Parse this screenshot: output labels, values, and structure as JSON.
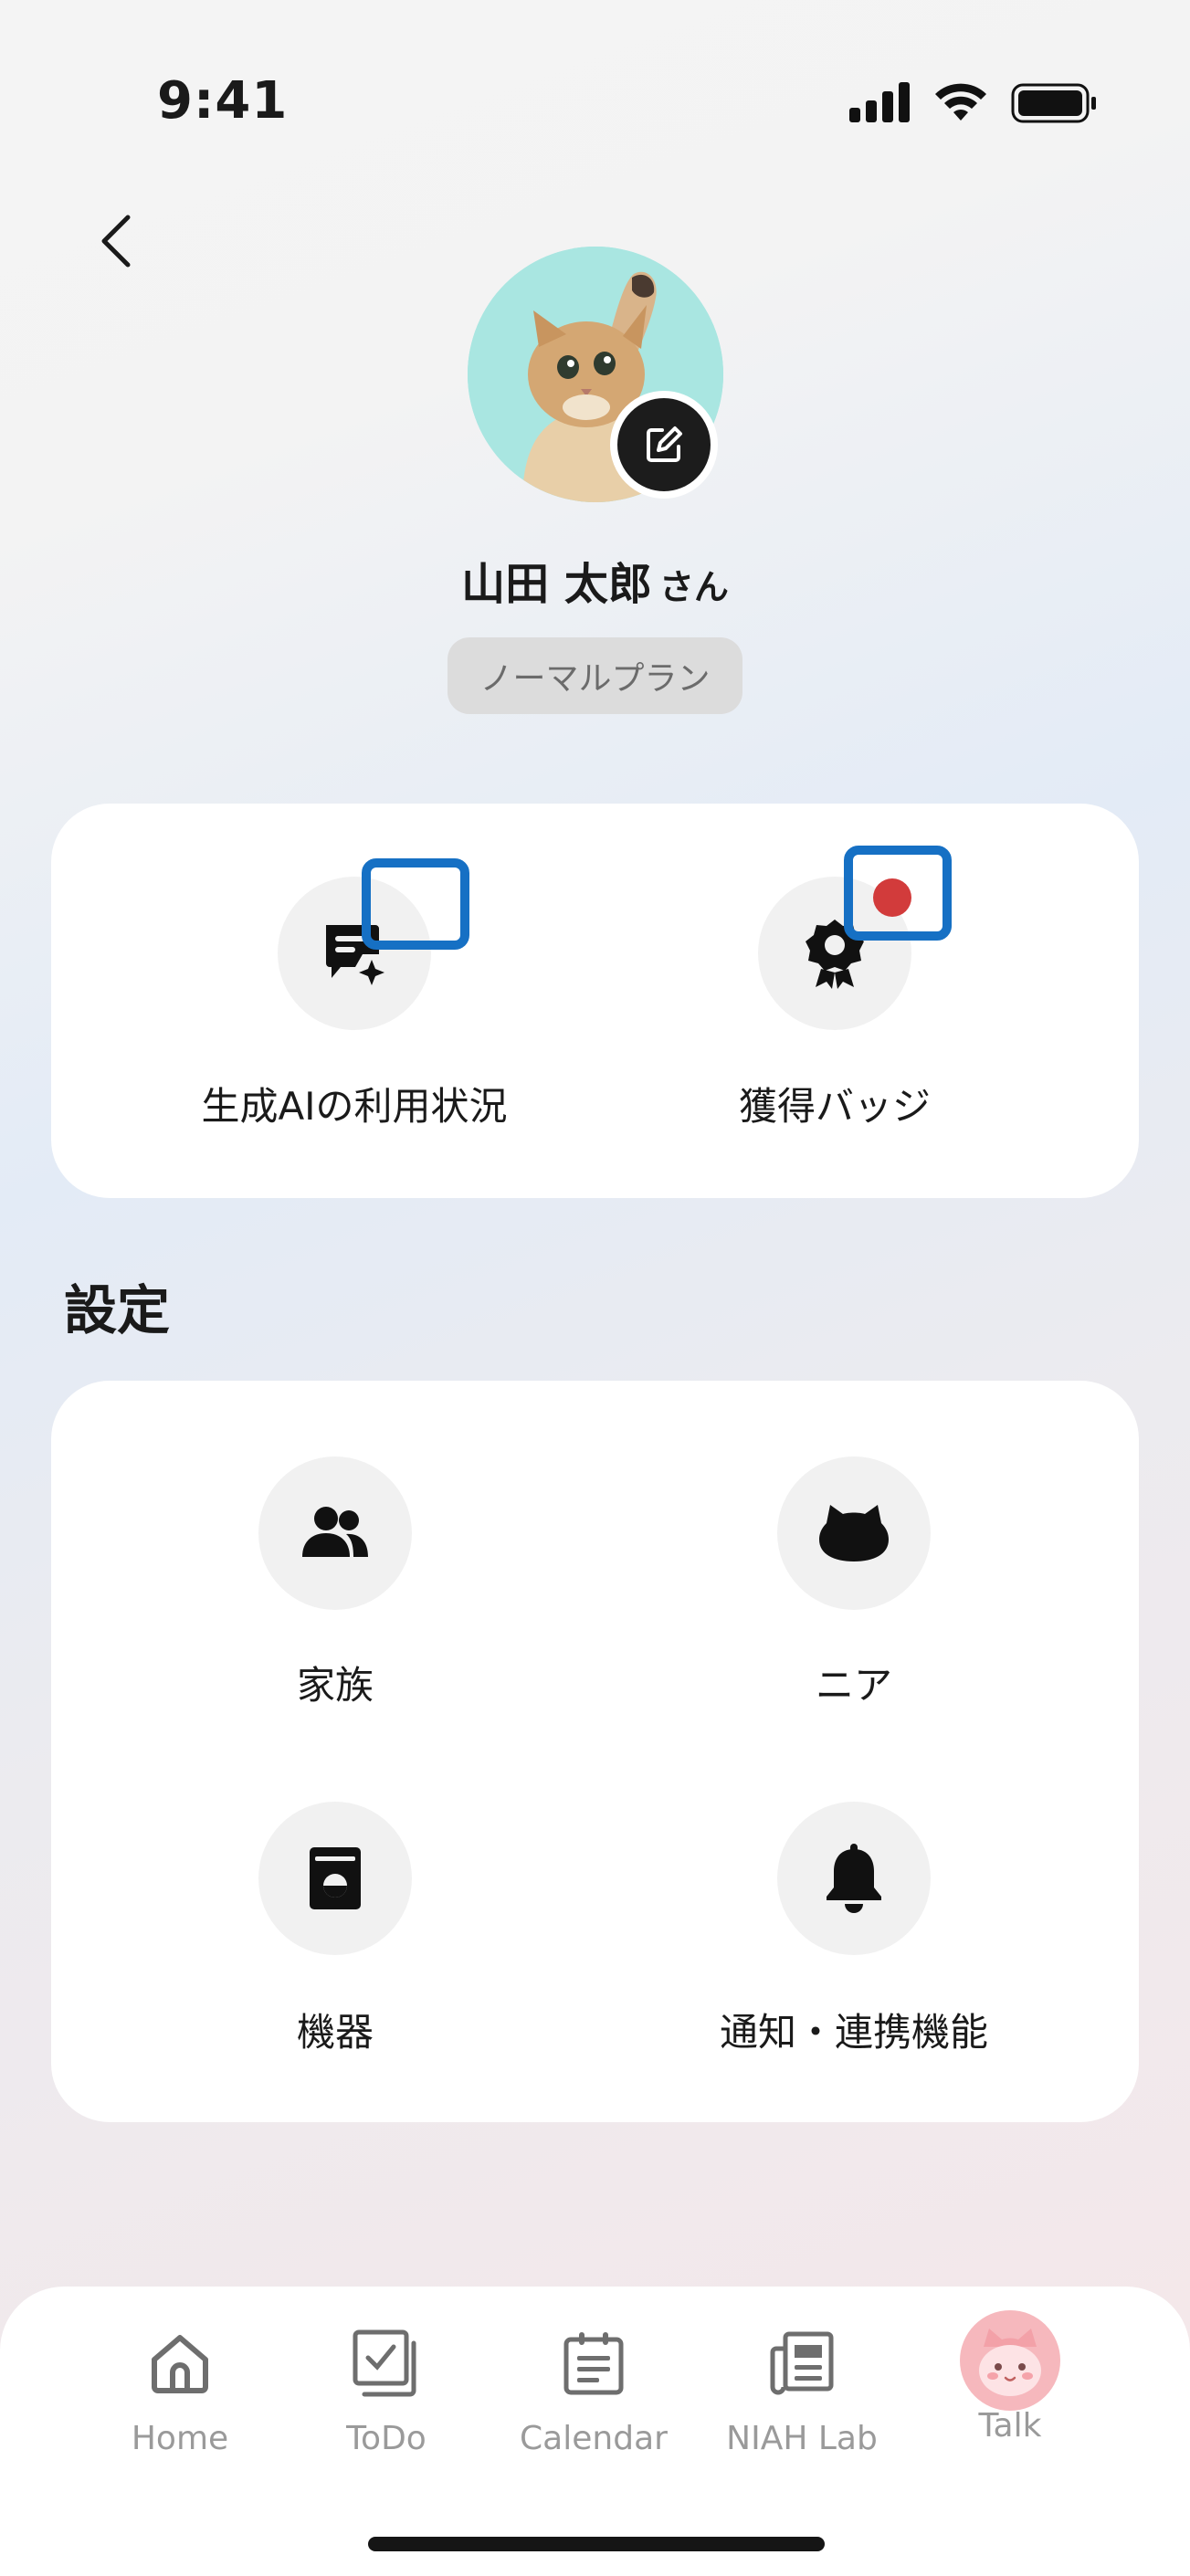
{
  "status_bar": {
    "time": "9:41"
  },
  "profile": {
    "name": "山田 太郎",
    "name_suffix": "さん",
    "plan": "ノーマルプラン"
  },
  "top_card": {
    "items": [
      {
        "label": "生成AIの利用状況",
        "icon": "ai-chat-sparkle-icon"
      },
      {
        "label": "獲得バッジ",
        "icon": "badge-award-icon"
      }
    ]
  },
  "settings": {
    "title": "設定",
    "items": [
      {
        "label": "家族",
        "icon": "people-icon"
      },
      {
        "label": "ニア",
        "icon": "character-face-icon"
      },
      {
        "label": "機器",
        "icon": "device-icon"
      },
      {
        "label": "通知・連携機能",
        "icon": "bell-icon"
      }
    ]
  },
  "tabbar": {
    "tabs": [
      {
        "label": "Home",
        "icon": "home-icon"
      },
      {
        "label": "ToDo",
        "icon": "todo-check-icon"
      },
      {
        "label": "Calendar",
        "icon": "calendar-icon"
      },
      {
        "label": "NIAH Lab",
        "icon": "news-icon"
      },
      {
        "label": "Talk",
        "icon": "talk-avatar-icon"
      }
    ]
  },
  "colors": {
    "highlight_outline": "#1670c4",
    "notification_dot": "#d23b3b",
    "avatar_background": "#a9e6e1",
    "tab_label": "#9a9a9a"
  }
}
